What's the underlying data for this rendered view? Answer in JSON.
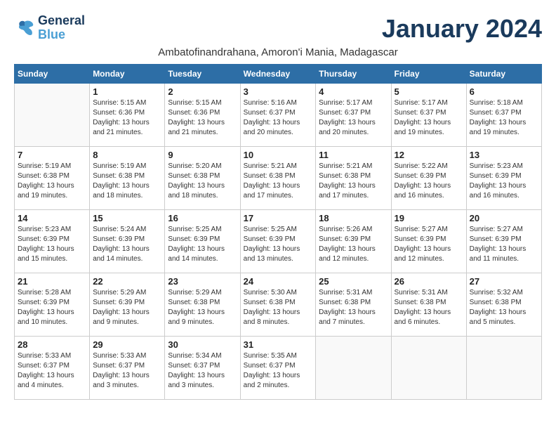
{
  "logo": {
    "text_general": "General",
    "text_blue": "Blue"
  },
  "title": "January 2024",
  "subtitle": "Ambatofinandrahana, Amoron'i Mania, Madagascar",
  "days_of_week": [
    "Sunday",
    "Monday",
    "Tuesday",
    "Wednesday",
    "Thursday",
    "Friday",
    "Saturday"
  ],
  "weeks": [
    [
      {
        "day": "",
        "info": ""
      },
      {
        "day": "1",
        "info": "Sunrise: 5:15 AM\nSunset: 6:36 PM\nDaylight: 13 hours\nand 21 minutes."
      },
      {
        "day": "2",
        "info": "Sunrise: 5:15 AM\nSunset: 6:36 PM\nDaylight: 13 hours\nand 21 minutes."
      },
      {
        "day": "3",
        "info": "Sunrise: 5:16 AM\nSunset: 6:37 PM\nDaylight: 13 hours\nand 20 minutes."
      },
      {
        "day": "4",
        "info": "Sunrise: 5:17 AM\nSunset: 6:37 PM\nDaylight: 13 hours\nand 20 minutes."
      },
      {
        "day": "5",
        "info": "Sunrise: 5:17 AM\nSunset: 6:37 PM\nDaylight: 13 hours\nand 19 minutes."
      },
      {
        "day": "6",
        "info": "Sunrise: 5:18 AM\nSunset: 6:37 PM\nDaylight: 13 hours\nand 19 minutes."
      }
    ],
    [
      {
        "day": "7",
        "info": "Sunrise: 5:19 AM\nSunset: 6:38 PM\nDaylight: 13 hours\nand 19 minutes."
      },
      {
        "day": "8",
        "info": "Sunrise: 5:19 AM\nSunset: 6:38 PM\nDaylight: 13 hours\nand 18 minutes."
      },
      {
        "day": "9",
        "info": "Sunrise: 5:20 AM\nSunset: 6:38 PM\nDaylight: 13 hours\nand 18 minutes."
      },
      {
        "day": "10",
        "info": "Sunrise: 5:21 AM\nSunset: 6:38 PM\nDaylight: 13 hours\nand 17 minutes."
      },
      {
        "day": "11",
        "info": "Sunrise: 5:21 AM\nSunset: 6:38 PM\nDaylight: 13 hours\nand 17 minutes."
      },
      {
        "day": "12",
        "info": "Sunrise: 5:22 AM\nSunset: 6:39 PM\nDaylight: 13 hours\nand 16 minutes."
      },
      {
        "day": "13",
        "info": "Sunrise: 5:23 AM\nSunset: 6:39 PM\nDaylight: 13 hours\nand 16 minutes."
      }
    ],
    [
      {
        "day": "14",
        "info": "Sunrise: 5:23 AM\nSunset: 6:39 PM\nDaylight: 13 hours\nand 15 minutes."
      },
      {
        "day": "15",
        "info": "Sunrise: 5:24 AM\nSunset: 6:39 PM\nDaylight: 13 hours\nand 14 minutes."
      },
      {
        "day": "16",
        "info": "Sunrise: 5:25 AM\nSunset: 6:39 PM\nDaylight: 13 hours\nand 14 minutes."
      },
      {
        "day": "17",
        "info": "Sunrise: 5:25 AM\nSunset: 6:39 PM\nDaylight: 13 hours\nand 13 minutes."
      },
      {
        "day": "18",
        "info": "Sunrise: 5:26 AM\nSunset: 6:39 PM\nDaylight: 13 hours\nand 12 minutes."
      },
      {
        "day": "19",
        "info": "Sunrise: 5:27 AM\nSunset: 6:39 PM\nDaylight: 13 hours\nand 12 minutes."
      },
      {
        "day": "20",
        "info": "Sunrise: 5:27 AM\nSunset: 6:39 PM\nDaylight: 13 hours\nand 11 minutes."
      }
    ],
    [
      {
        "day": "21",
        "info": "Sunrise: 5:28 AM\nSunset: 6:39 PM\nDaylight: 13 hours\nand 10 minutes."
      },
      {
        "day": "22",
        "info": "Sunrise: 5:29 AM\nSunset: 6:39 PM\nDaylight: 13 hours\nand 9 minutes."
      },
      {
        "day": "23",
        "info": "Sunrise: 5:29 AM\nSunset: 6:38 PM\nDaylight: 13 hours\nand 9 minutes."
      },
      {
        "day": "24",
        "info": "Sunrise: 5:30 AM\nSunset: 6:38 PM\nDaylight: 13 hours\nand 8 minutes."
      },
      {
        "day": "25",
        "info": "Sunrise: 5:31 AM\nSunset: 6:38 PM\nDaylight: 13 hours\nand 7 minutes."
      },
      {
        "day": "26",
        "info": "Sunrise: 5:31 AM\nSunset: 6:38 PM\nDaylight: 13 hours\nand 6 minutes."
      },
      {
        "day": "27",
        "info": "Sunrise: 5:32 AM\nSunset: 6:38 PM\nDaylight: 13 hours\nand 5 minutes."
      }
    ],
    [
      {
        "day": "28",
        "info": "Sunrise: 5:33 AM\nSunset: 6:37 PM\nDaylight: 13 hours\nand 4 minutes."
      },
      {
        "day": "29",
        "info": "Sunrise: 5:33 AM\nSunset: 6:37 PM\nDaylight: 13 hours\nand 3 minutes."
      },
      {
        "day": "30",
        "info": "Sunrise: 5:34 AM\nSunset: 6:37 PM\nDaylight: 13 hours\nand 3 minutes."
      },
      {
        "day": "31",
        "info": "Sunrise: 5:35 AM\nSunset: 6:37 PM\nDaylight: 13 hours\nand 2 minutes."
      },
      {
        "day": "",
        "info": ""
      },
      {
        "day": "",
        "info": ""
      },
      {
        "day": "",
        "info": ""
      }
    ]
  ]
}
